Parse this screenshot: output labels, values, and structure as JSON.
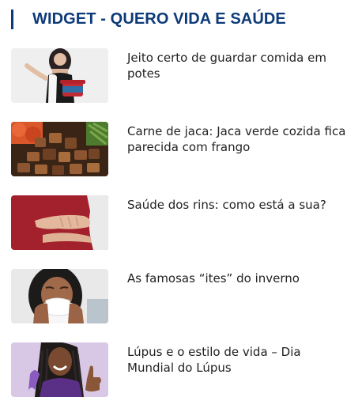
{
  "widget": {
    "title": "WIDGET - QUERO VIDA E SAÚDE",
    "accent_color": "#0d3a78",
    "items": [
      {
        "title": "Jeito certo de guardar comida em potes",
        "image": "woman-holding-food-container"
      },
      {
        "title": "Carne de jaca: Jaca verde cozida fica parecida com frango",
        "image": "jackfruit-meat-dish"
      },
      {
        "title": "Saúde dos rins: como está a sua?",
        "image": "person-holding-side"
      },
      {
        "title": "As famosas “ites” do inverno",
        "image": "woman-sneezing-tissue"
      },
      {
        "title": "Lúpus e o estilo de vida – Dia Mundial do Lúpus",
        "image": "woman-with-purple-ribbon-thumbs-up"
      }
    ]
  }
}
